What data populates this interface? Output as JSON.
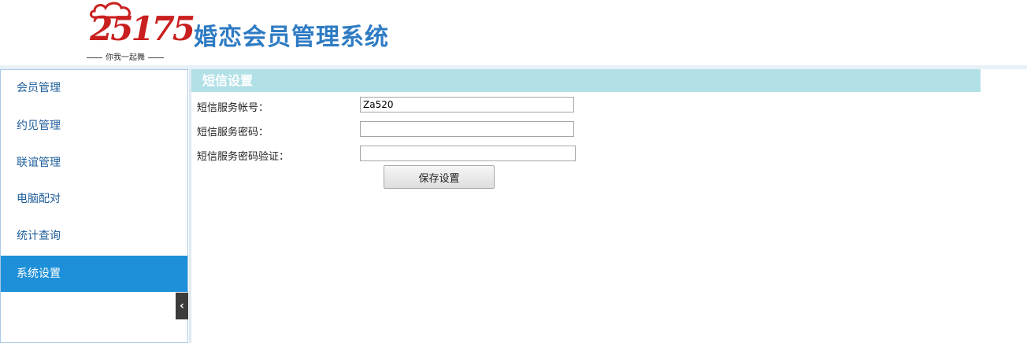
{
  "header": {
    "logo_number": "25175",
    "logo_tagline": "你我一起舞",
    "title": "婚恋会员管理系统"
  },
  "sidebar": {
    "items": [
      {
        "label": "会员管理",
        "active": false
      },
      {
        "label": "约见管理",
        "active": false
      },
      {
        "label": "联谊管理",
        "active": false
      },
      {
        "label": "电脑配对",
        "active": false
      },
      {
        "label": "统计查询",
        "active": false
      },
      {
        "label": "系统设置",
        "active": true
      }
    ],
    "collapse_glyph": "‹"
  },
  "panel": {
    "title": "短信设置",
    "fields": [
      {
        "label": "短信服务帐号：",
        "value": ""
      },
      {
        "label": "短信服务密码：",
        "value": ""
      },
      {
        "label": "短信服务密码验证：",
        "value": ""
      }
    ],
    "account_value": "Za520",
    "save_label": "保存设置"
  },
  "colors": {
    "accent": "#1e90d9",
    "title": "#2e7bc4",
    "panel_header": "#b1e0e6",
    "logo_red": "#c9201f"
  }
}
